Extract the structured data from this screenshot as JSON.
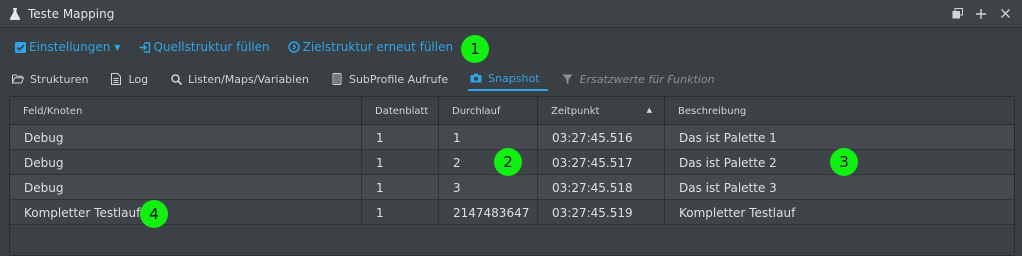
{
  "window": {
    "title": "Teste Mapping",
    "icons": [
      "flask-icon",
      "restore-icon",
      "plus-icon",
      "close-icon"
    ]
  },
  "toolbar": {
    "settings_label": "Einstellungen",
    "fill_source_label": "Quellstruktur füllen",
    "refill_target_label": "Zielstruktur erneut füllen",
    "accent_color": "#2fa4e7"
  },
  "tabs": [
    {
      "label": "Strukturen",
      "icon": "folder-open-icon",
      "state": "normal"
    },
    {
      "label": "Log",
      "icon": "document-icon",
      "state": "normal"
    },
    {
      "label": "Listen/Maps/Variablen",
      "icon": "search-icon",
      "state": "normal"
    },
    {
      "label": "SubProfile Aufrufe",
      "icon": "subprofile-icon",
      "state": "normal"
    },
    {
      "label": "Snapshot",
      "icon": "camera-icon",
      "state": "active"
    },
    {
      "label": "Ersatzwerte für Funktion",
      "icon": "filter-icon",
      "state": "disabled"
    }
  ],
  "table": {
    "columns": [
      "Feld/Knoten",
      "Datenblatt",
      "Durchlauf",
      "Zeitpunkt",
      "Beschreibung"
    ],
    "sorted_column": "Zeitpunkt",
    "sort_direction": "ascending",
    "rows": [
      [
        "Debug",
        "1",
        "1",
        "03:27:45.516",
        "Das ist Palette 1"
      ],
      [
        "Debug",
        "1",
        "2",
        "03:27:45.517",
        "Das ist Palette 2"
      ],
      [
        "Debug",
        "1",
        "3",
        "03:27:45.518",
        "Das ist Palette 3"
      ],
      [
        "Kompletter Testlauf",
        "1",
        "2147483647",
        "03:27:45.519",
        "Kompletter Testlauf"
      ]
    ]
  },
  "markers": [
    "1",
    "2",
    "3",
    "4"
  ],
  "marker_color": "#12f012"
}
